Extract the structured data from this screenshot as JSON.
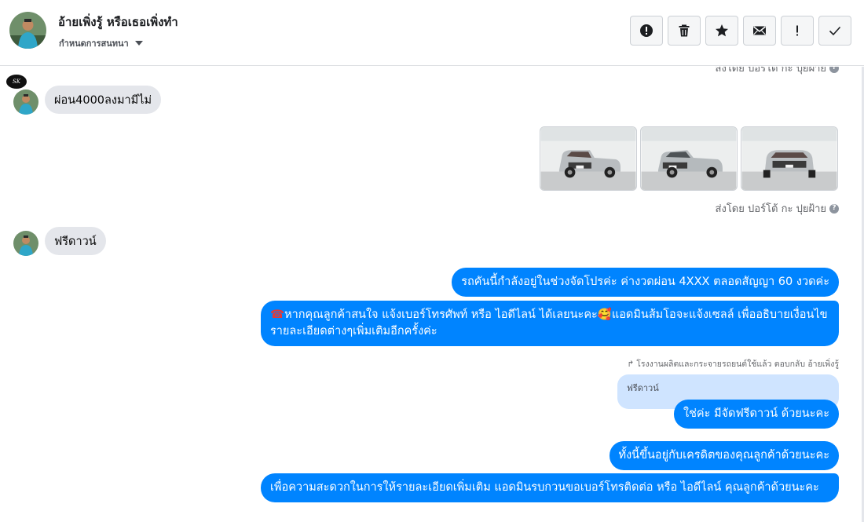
{
  "header": {
    "contact_name": "อ้ายเพิ่งรู้ หรือเธอเพิ่งทำ",
    "sub_label": "กำหนดการสนทนา",
    "toolbar": [
      {
        "name": "spam-button",
        "icon": "alert-circle-icon"
      },
      {
        "name": "delete-button",
        "icon": "trash-icon"
      },
      {
        "name": "star-button",
        "icon": "star-icon"
      },
      {
        "name": "mark-unread-button",
        "icon": "envelope-icon"
      },
      {
        "name": "follow-up-button",
        "icon": "exclamation-icon"
      },
      {
        "name": "done-button",
        "icon": "check-icon"
      }
    ]
  },
  "thread": {
    "sent_by_top": "ส่งโดย ปอร์โต้ กะ ปุยฝ้าย",
    "page_logo_text": "SK",
    "msg_in_1": "ผ่อน4000ลงมามีไม่",
    "sent_by_photos": "ส่งโดย ปอร์โต้ กะ ปุยฝ้าย",
    "msg_in_2": "ฟรีดาวน์",
    "msg_out_1": "รถคันนี้กำลังอยู่ในช่วงจัดโปรค่ะ ค่างวดผ่อน 4XXX ตลอดสัญญา 60 งวดค่ะ",
    "msg_out_2_emoji_1": "☎",
    "msg_out_2_part_1": "หากคุณลูกค้าสนใจ แจ้งเบอร์โทรศัพท์ หรือ ไอดีไลน์  ได้เลยนะคะ",
    "msg_out_2_emoji_2": "🥰",
    "msg_out_2_part_2": "แอดมินส้มโอจะแจ้งเซลล์   เพื่ออธิบายเงื่อนไขรายละเอียดต่างๆเพิ่มเติมอีกครั้งค่ะ",
    "reply_meta": "โรงงานผลิตและกระจายรถยนต์ใช้แล้ว ตอบกลับ อ้ายเพิ่งรู้",
    "quoted_text": "ฟรีดาวน์",
    "msg_out_3": "ใช่ค่ะ มีจัดฟรีดาวน์ ด้วยนะคะ",
    "msg_out_4": "ทั้งนี้ขึ้นอยู่กับเครดิตของคุณลูกค้าด้วยนะคะ",
    "msg_out_5": "เพื่อความสะดวกในการให้รายละเอียดเพิ่มเติม แอดมินรบกวนขอเบอร์โทรติดต่อ หรือ ไอดีไลน์ คุณลูกค้าด้วยนะคะ"
  },
  "colors": {
    "accent": "#0084ff",
    "incoming_bubble": "#e4e6eb",
    "quoted_bubble": "#cfe4ff"
  }
}
